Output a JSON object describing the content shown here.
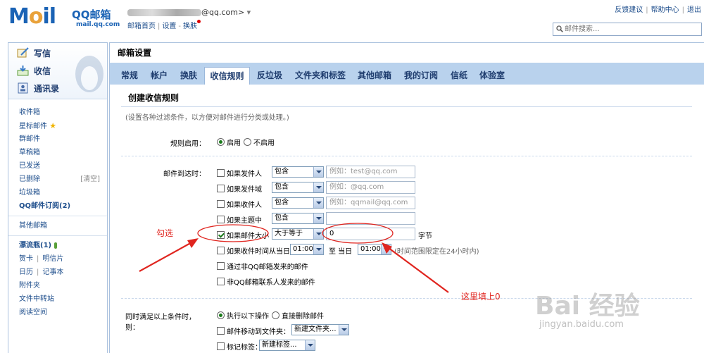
{
  "header": {
    "logo_text": "M",
    "logo_tail": "il",
    "brand": "QQ邮箱",
    "domain": "mail.qq.com",
    "email_suffix": "@qq.com>",
    "email_caret": "▾",
    "links": [
      "邮箱首页",
      "设置",
      "换肤"
    ],
    "top_links": [
      "反馈建议",
      "帮助中心",
      "退出"
    ],
    "search_placeholder": "邮件搜索..."
  },
  "sidebar": {
    "actions": [
      {
        "label": "写信",
        "icon": "compose-icon"
      },
      {
        "label": "收信",
        "icon": "inbox-download-icon"
      },
      {
        "label": "通讯录",
        "icon": "contacts-icon"
      }
    ],
    "folders": [
      {
        "label": "收件箱"
      },
      {
        "label": "星标邮件",
        "star": "★"
      },
      {
        "label": "群邮件"
      },
      {
        "label": "草稿箱"
      },
      {
        "label": "已发送"
      },
      {
        "label": "已删除",
        "aux": "[清空]"
      },
      {
        "label": "垃圾箱"
      },
      {
        "label": "QQ邮件订阅(2)",
        "bold": true
      }
    ],
    "other_folders": {
      "label": "其他邮箱"
    },
    "extras": {
      "drift": "漂流瓶(1)",
      "cards": [
        "贺卡",
        "明信片"
      ],
      "calendar": [
        "日历",
        "记事本"
      ],
      "items": [
        "附件夹",
        "文件中转站",
        "阅读空间"
      ]
    }
  },
  "main": {
    "title": "邮箱设置",
    "tabs": [
      "常规",
      "帐户",
      "换肤",
      "收信规则",
      "反垃圾",
      "文件夹和标签",
      "其他邮箱",
      "我的订阅",
      "信纸",
      "体验室"
    ],
    "active_tab": 3,
    "section_title": "创建收信规则",
    "hint": "(设置各种过滤条件，以方便对邮件进行分类或处理。)",
    "rule_enable": {
      "label": "规则启用：",
      "on": "启用",
      "off": "不启用"
    },
    "conditions_label": "邮件到达时：",
    "conditions": [
      {
        "label": "如果发件人",
        "op": "包含",
        "placeholder": "例如：test@qq.com",
        "checked": false
      },
      {
        "label": "如果发件域",
        "op": "包含",
        "placeholder": "例如：@qq.com",
        "checked": false
      },
      {
        "label": "如果收件人",
        "op": "包含",
        "placeholder": "例如：qqmail@qq.com",
        "checked": false
      },
      {
        "label": "如果主题中",
        "op": "包含",
        "placeholder": "",
        "checked": false
      },
      {
        "label": "如果邮件大小",
        "op": "大于等于",
        "value": "0",
        "unit": "字节",
        "checked": true
      }
    ],
    "time_row": {
      "label": "如果收件时间从当日",
      "from": "01:00",
      "to_label": "至 当日",
      "to": "01:00",
      "note": "(时间范围限定在24小时内)"
    },
    "non_qq": "通过非QQ邮箱发来的邮件",
    "non_contact": "非QQ邮箱联系人发来的邮件",
    "actions_label": "同时满足以上条件时，则：",
    "action_exec": "执行以下操作",
    "action_delete": "直接删除邮件",
    "move_label": "邮件移动到文件夹：",
    "move_value": "新建文件夹...",
    "tag_label": "标记标签：",
    "tag_value": "新建标签..."
  },
  "annotations": {
    "check_note": "勾选",
    "fill_note": "这里填上0",
    "color": "#e0251f"
  },
  "watermark": {
    "text": "Bai 经验",
    "sub": "jingyan.baidu.com"
  }
}
